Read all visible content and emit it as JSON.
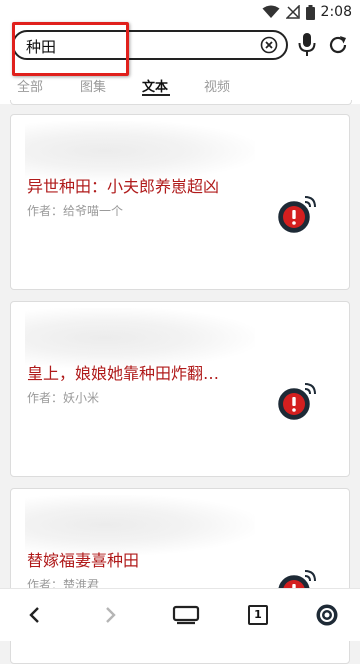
{
  "status_bar": {
    "time": "2:08",
    "icons": [
      "wifi-icon",
      "signal-off-icon",
      "battery-icon"
    ]
  },
  "search": {
    "value": "种田"
  },
  "tabs": [
    {
      "label": "全部",
      "active": false
    },
    {
      "label": "图集",
      "active": false
    },
    {
      "label": "文本",
      "active": true
    },
    {
      "label": "视频",
      "active": false
    }
  ],
  "results": [
    {
      "title": "异世种田：小夫郎养崽超凶",
      "author": "作者：给爷喵一个"
    },
    {
      "title": "皇上，娘娘她靠种田炸翻…",
      "author": "作者：妖小米"
    },
    {
      "title": "替嫁福妻喜种田",
      "author": "作者：楚淮君"
    }
  ],
  "bottom_nav": {
    "tab_count": "1"
  },
  "colors": {
    "title_red": "#b01b1b",
    "highlight_red": "#e0201c",
    "text_gray": "#9a9a9a"
  }
}
